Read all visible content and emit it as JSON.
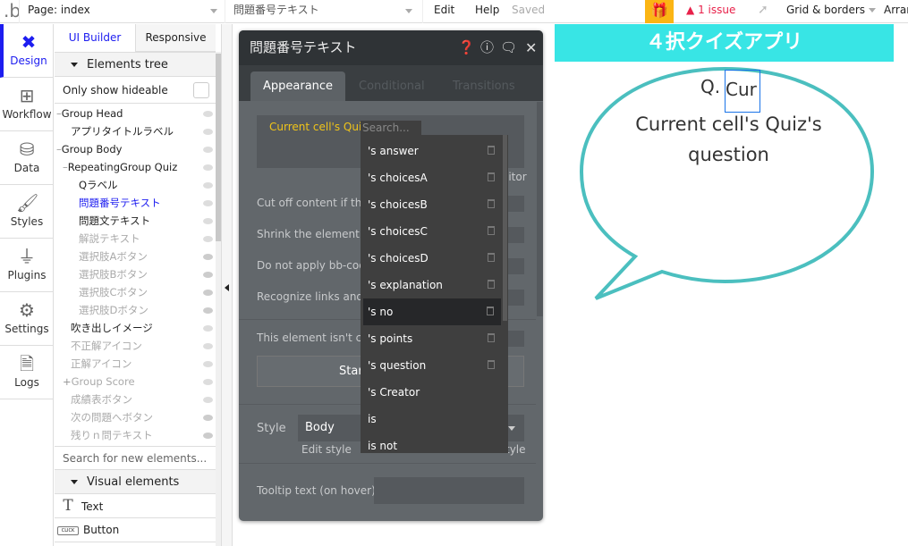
{
  "topbar": {
    "logo": ".b",
    "page_select": "Page: index",
    "element_select": "問題番号テキスト",
    "edit": "Edit",
    "help": "Help",
    "saved": "Saved",
    "issues": "1 issue",
    "grid": "Grid & borders",
    "arrange": "Arran"
  },
  "rail": [
    {
      "label": "Design",
      "icon": "design-icon"
    },
    {
      "label": "Workflow",
      "icon": "workflow-icon"
    },
    {
      "label": "Data",
      "icon": "database-icon"
    },
    {
      "label": "Styles",
      "icon": "brush-icon"
    },
    {
      "label": "Plugins",
      "icon": "plug-icon"
    },
    {
      "label": "Settings",
      "icon": "gear-icon"
    },
    {
      "label": "Logs",
      "icon": "document-icon"
    }
  ],
  "panel": {
    "tabs": [
      "UI Builder",
      "Responsive"
    ],
    "elements_tree": "Elements tree",
    "only_hideable": "Only show hideable",
    "tree": [
      {
        "label": "Group Head",
        "prefix": "—",
        "indent": 0,
        "state": "normal",
        "eye": "on"
      },
      {
        "label": "アプリタイトルラベル",
        "prefix": "",
        "indent": 1,
        "state": "normal",
        "eye": "on"
      },
      {
        "label": "Group Body",
        "prefix": "—",
        "indent": 0,
        "state": "normal",
        "eye": "on"
      },
      {
        "label": "RepeatingGroup Quiz",
        "prefix": "—",
        "indent": 1,
        "state": "normal",
        "eye": "on"
      },
      {
        "label": "Qラベル",
        "prefix": "",
        "indent": 2,
        "state": "normal",
        "eye": "on"
      },
      {
        "label": "問題番号テキスト",
        "prefix": "",
        "indent": 2,
        "state": "selected",
        "eye": "on"
      },
      {
        "label": "問題文テキスト",
        "prefix": "",
        "indent": 2,
        "state": "normal",
        "eye": "on"
      },
      {
        "label": "解説テキスト",
        "prefix": "",
        "indent": 2,
        "state": "hidden",
        "eye": "on"
      },
      {
        "label": "選択肢Aボタン",
        "prefix": "",
        "indent": 2,
        "state": "hidden",
        "eye": "off"
      },
      {
        "label": "選択肢Bボタン",
        "prefix": "",
        "indent": 2,
        "state": "hidden",
        "eye": "off"
      },
      {
        "label": "選択肢Cボタン",
        "prefix": "",
        "indent": 2,
        "state": "hidden",
        "eye": "off"
      },
      {
        "label": "選択肢Dボタン",
        "prefix": "",
        "indent": 2,
        "state": "hidden",
        "eye": "off"
      },
      {
        "label": "吹き出しイメージ",
        "prefix": "",
        "indent": 1,
        "state": "normal",
        "eye": "on"
      },
      {
        "label": "不正解アイコン",
        "prefix": "",
        "indent": 1,
        "state": "hidden",
        "eye": "on"
      },
      {
        "label": "正解アイコン",
        "prefix": "",
        "indent": 1,
        "state": "hidden",
        "eye": "on"
      },
      {
        "label": "Group Score",
        "prefix": "+",
        "indent": 1,
        "state": "hidden",
        "eye": "on"
      },
      {
        "label": "成績表ボタン",
        "prefix": "",
        "indent": 1,
        "state": "hidden",
        "eye": "on"
      },
      {
        "label": "次の問題へボタン",
        "prefix": "",
        "indent": 1,
        "state": "hidden",
        "eye": "off"
      },
      {
        "label": "残りｎ問テキスト",
        "prefix": "",
        "indent": 1,
        "state": "hidden",
        "eye": "off"
      }
    ],
    "search_placeholder": "Search for new elements...",
    "visual_elements": "Visual elements",
    "palette": [
      {
        "label": "Text",
        "icon": "text-icon"
      },
      {
        "label": "Button",
        "icon": "button-icon",
        "badge": "CLICK"
      }
    ]
  },
  "editor": {
    "title": "問題番号テキスト",
    "tabs": [
      "Appearance",
      "Conditional",
      "Transitions"
    ],
    "expression": "Current cell's Quiz",
    "editor_link": "litor",
    "rows": [
      "Cut off content if the",
      "Shrink the element h",
      "Do not apply bb-code",
      "Recognize links and e",
      "This element isn't clic"
    ],
    "start_button": "Star",
    "style_label": "Style",
    "style_value": "Body",
    "edit_style": "Edit style",
    "style_right": "tyle",
    "tooltip_label": "Tooltip text (on hover)"
  },
  "dropdown": {
    "search_placeholder": "Search...",
    "items": [
      "'s answer",
      "'s choicesA",
      "'s choicesB",
      "'s choicesC",
      "'s choicesD",
      "'s explanation",
      "'s no",
      "'s points",
      "'s question",
      "'s Creator",
      "is",
      "is not"
    ],
    "highlighted": 6,
    "trash_count": 9
  },
  "canvas": {
    "app_title": "４択クイズアプリ",
    "q_label": "Q.",
    "q_number": "Cur",
    "question": "Current cell's Quiz's question"
  },
  "colors": {
    "accent": "#1d1df0",
    "header_cyan": "#38e5e5",
    "bubble_stroke": "#4bbfbf",
    "issue": "#e8214a",
    "gift": "#fbb514",
    "expression": "#f0c419"
  }
}
